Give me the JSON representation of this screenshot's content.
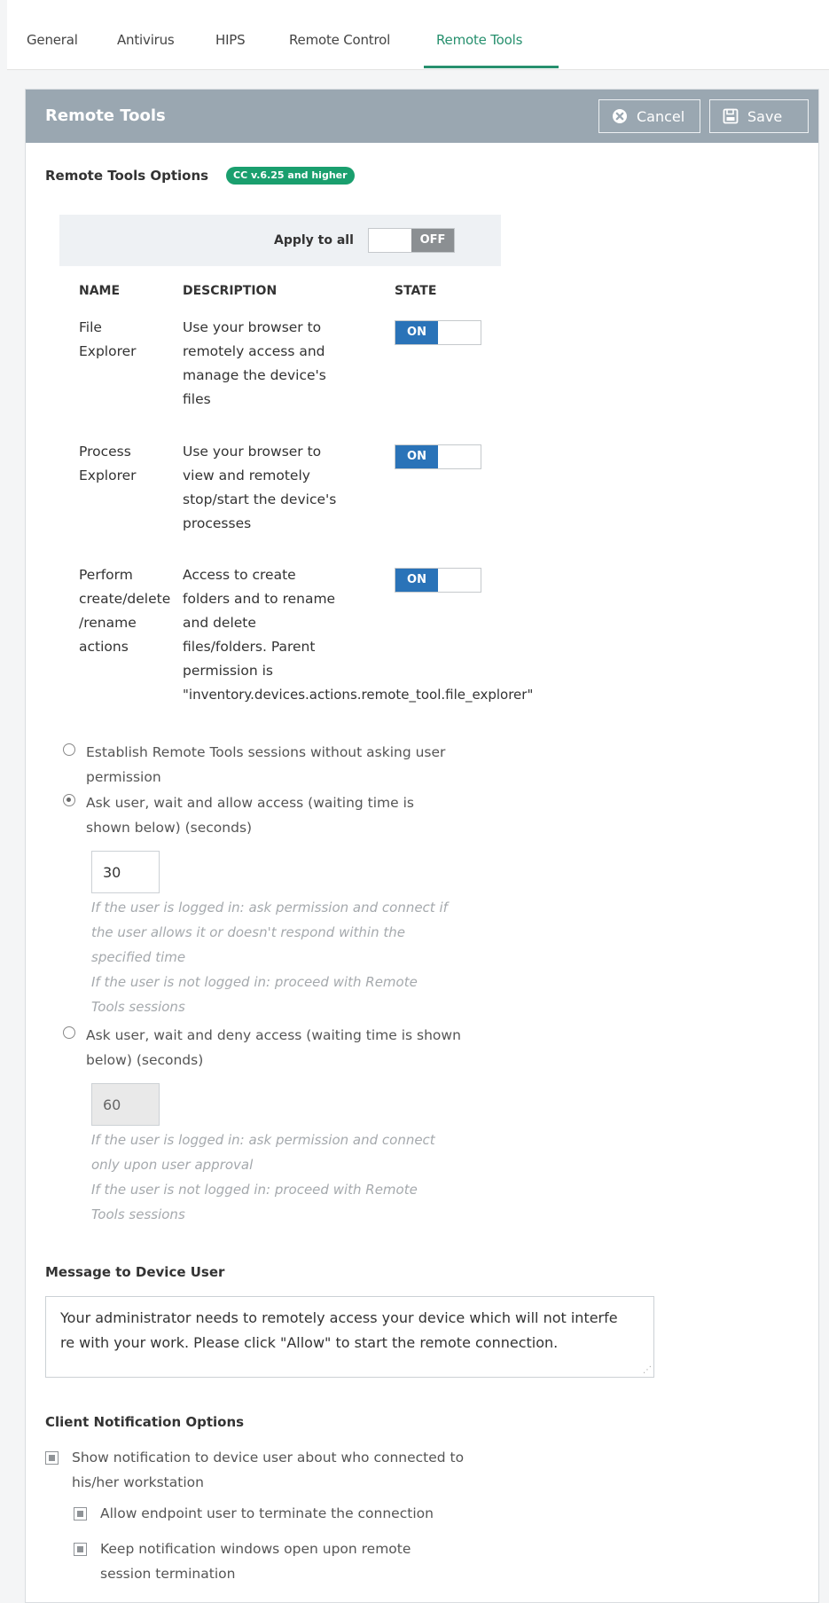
{
  "tabs": [
    "General",
    "Antivirus",
    "HIPS",
    "Remote Control",
    "Remote Tools"
  ],
  "header": {
    "title": "Remote Tools",
    "cancel_label": "Cancel",
    "save_label": "Save"
  },
  "options": {
    "title": "Remote Tools Options",
    "badge": "CC v.6.25 and higher",
    "apply_to_all_label": "Apply to all",
    "apply_to_all_state": "OFF"
  },
  "table": {
    "headers": [
      "NAME",
      "DESCRIPTION",
      "STATE"
    ],
    "rows": [
      {
        "name_lines": [
          "File",
          "Explorer"
        ],
        "desc_lines": [
          "Use your browser to",
          "remotely access and",
          "manage the device's",
          "files"
        ],
        "state": "ON"
      },
      {
        "name_lines": [
          "Process",
          "Explorer"
        ],
        "desc_lines": [
          "Use your browser to",
          "view and remotely",
          "stop/start the device's",
          "processes"
        ],
        "state": "ON"
      },
      {
        "name_lines": [
          "Perform",
          "create/delete",
          "/rename",
          "actions"
        ],
        "desc_lines": [
          "Access to create",
          "folders and to rename",
          "and delete",
          "files/folders. Parent",
          "permission is",
          "\"inventory.devices.actions.remote_tool.file_explorer\""
        ],
        "state": "ON"
      }
    ]
  },
  "session_options": [
    {
      "lines": [
        "Establish Remote Tools sessions without asking user",
        "permission"
      ],
      "checked": false
    },
    {
      "lines": [
        "Ask user, wait and allow access (waiting time is",
        "shown below)  (seconds)"
      ],
      "checked": true,
      "value": "30",
      "hint_lines": [
        "If the user is logged in: ask permission and connect if",
        "the user allows it or doesn't respond within the",
        "specified time",
        "If the user is not logged in: proceed with Remote",
        "Tools sessions"
      ]
    },
    {
      "lines": [
        "Ask user, wait and deny access (waiting time is shown",
        "below)  (seconds)"
      ],
      "checked": false,
      "value": "60",
      "hint_lines": [
        "If the user is logged in: ask permission and connect",
        "only upon user approval",
        "If the user is not logged in: proceed with Remote",
        "Tools sessions"
      ]
    }
  ],
  "message": {
    "title": "Message to Device User",
    "lines": [
      "Your administrator needs to remotely access your device which will not interfe",
      "re with your work. Please click \"Allow\" to start the remote connection."
    ]
  },
  "notifications": {
    "title": "Client Notification Options",
    "items": [
      {
        "lines": [
          "Show notification to device user about who connected to",
          "his/her workstation"
        ],
        "checked": true
      },
      {
        "lines": [
          "Allow endpoint user to terminate the connection"
        ],
        "checked": true
      },
      {
        "lines": [
          "Keep notification windows open upon remote",
          "session termination"
        ],
        "checked": true
      }
    ]
  },
  "colors": {
    "accent": "#27906e",
    "header_bg": "#9aa7b1",
    "toggle_on": "#2a73b8",
    "toggle_off": "#8b8f92",
    "badge": "#1a9f6e"
  }
}
